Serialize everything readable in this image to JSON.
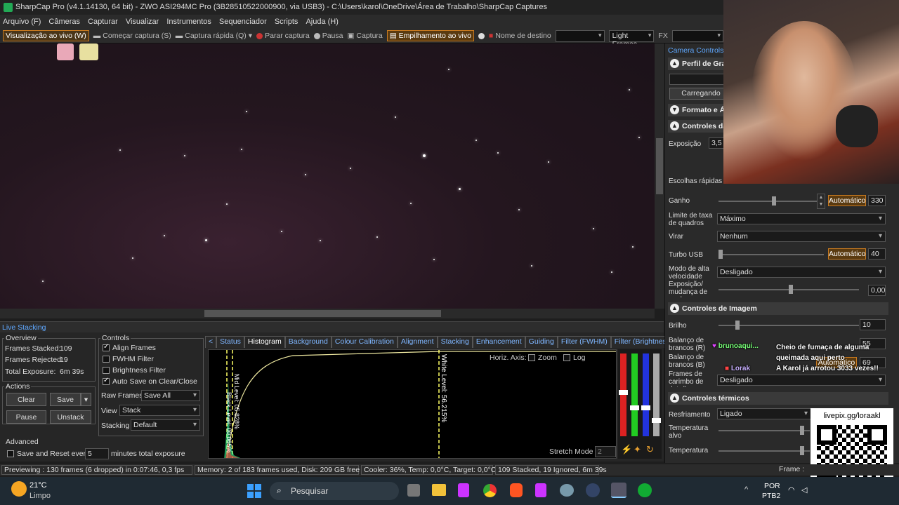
{
  "window": {
    "title": "SharpCap Pro (v4.1.14130, 64 bit) - ZWO ASI294MC Pro (3B28510522000900, via USB3) - C:\\Users\\karol\\OneDrive\\Área de Trabalho\\SharpCap Captures"
  },
  "menu": [
    "Arquivo (F)",
    "Câmeras",
    "Capturar",
    "Visualizar",
    "Instrumentos",
    "Sequenciador",
    "Scripts",
    "Ajuda (H)"
  ],
  "toolbar": {
    "live_view": "Visualização ao vivo (W)",
    "start_capture": "Começar captura (S)",
    "quick_capture": "Captura rápida (Q)",
    "stop_capture": "Parar captura",
    "pause": "Pausa",
    "capture": "Captura",
    "live_stack": "Empilhamento ao vivo",
    "target_name": "Nome de destino",
    "target_value": "",
    "frames_select": "Light Frames",
    "fx": "FX",
    "fx_value": ""
  },
  "live_stacking": {
    "header": "Live Stacking",
    "overview_label": "Overview",
    "frames_stacked_label": "Frames Stacked:",
    "frames_stacked": "109",
    "frames_rejected_label": "Frames Rejected:",
    "frames_rejected": "19",
    "total_exposure_label": "Total Exposure:",
    "total_exposure": "6m 39s",
    "actions_label": "Actions",
    "clear": "Clear",
    "save": "Save",
    "pause": "Pause",
    "unstack": "Unstack",
    "advanced_label": "Advanced",
    "save_reset": "Save and Reset every",
    "save_reset_value": "5",
    "minutes": "minutes total exposure",
    "controls_label": "Controls",
    "align_frames": "Align Frames",
    "fwhm_filter": "FWHM Filter",
    "brightness_filter": "Brightness Filter",
    "auto_save": "Auto Save on Clear/Close",
    "raw_frames_label": "Raw Frames",
    "raw_frames_value": "Save All",
    "view_label": "View",
    "view_value": "Stack",
    "stacking_label": "Stacking",
    "stacking_value": "Default",
    "tabs": [
      "Status",
      "Histogram",
      "Background",
      "Colour Calibration",
      "Alignment",
      "Stacking",
      "Enhancement",
      "Guiding",
      "Filter (FWHM)",
      "Filter (Brightness)",
      "D"
    ],
    "horiz_axis": "Horiz. Axis:",
    "zoom": "Zoom",
    "log": "Log",
    "white_level": "White Level: 56.215%",
    "mid_level": "Mid Level: 05.828%",
    "black_level": "Black Level: 00.065%",
    "stretch_mode": "Stretch Mode",
    "stretch_value": "2"
  },
  "camera_controls": {
    "title": "Camera Controls",
    "profile_section": "Perfil de Gra",
    "loading": "Carregando",
    "format_section": "Formato e Á",
    "controls_section": "Controles da",
    "exposure_label": "Exposição",
    "exposure_value": "3,5",
    "quick_choices": "Escolhas rápidas",
    "gain_label": "Ganho",
    "gain_auto": "Automático",
    "gain_value": "330",
    "frame_rate_label": "Limite de taxa de quadros",
    "frame_rate_value": "Máximo",
    "flip_label": "Virar",
    "flip_value": "Nenhum",
    "usb_turbo_label": "Turbo USB",
    "usb_auto": "Automático",
    "usb_value": "40",
    "high_speed_label": "Modo de alta velocidade",
    "high_speed_value": "Desligado",
    "exp_gain_change_label": "Exposição/ mudança de ganho",
    "exp_gain_change_value": "0,00",
    "image_controls_section": "Controles de Imagem",
    "brightness_label": "Brilho",
    "brightness_value": "10",
    "wb_r_label": "Balanço de brancos (R)",
    "wb_r_value": "55",
    "wb_b_label": "Balanço de brancos (B)",
    "wb_b_auto": "Automático",
    "wb_b_value": "69",
    "timestamp_label": "Frames de carimbo de data/hora",
    "timestamp_value": "Desligado",
    "thermal_section": "Controles térmicos",
    "cooling_label": "Resfriamento",
    "cooling_value": "Ligado",
    "target_temp_label": "Temperatura alvo",
    "temp_label": "Temperatura"
  },
  "statusbar": {
    "preview": "Previewing : 130 frames (6 dropped) in 0:07:46, 0,3 fps",
    "memory": "Memory: 2 of 183 frames used, Disk: 209 GB free",
    "cooler": "Cooler: 36%, Temp: 0,0°C, Target: 0,0°C",
    "stacked": "109 Stacked, 19 Ignored, 6m 39s",
    "frame": "Frame :"
  },
  "taskbar": {
    "temperature": "21°C",
    "weather": "Limpo",
    "search": "Pesquisar",
    "language": "POR",
    "layout": "PTB2"
  },
  "overlay": {
    "chat": [
      {
        "user": "brunoaqui...",
        "message": "Cheio de fumaça de alguma queimada aqui perto"
      },
      {
        "user": "Lorak",
        "message": "A Karol já arrotou 3033 vezes!!"
      }
    ],
    "qr_url": "livepix.gg/loraakl"
  }
}
